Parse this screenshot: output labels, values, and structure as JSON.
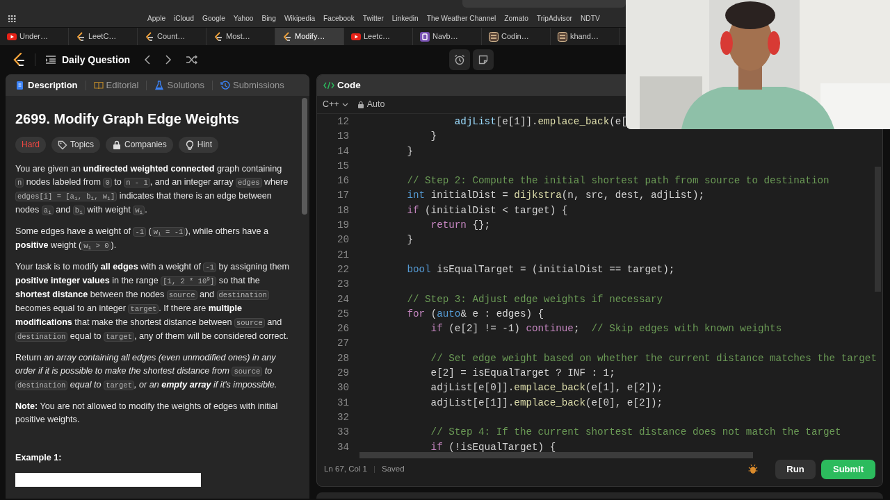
{
  "browser": {
    "bookmarks": [
      "Apple",
      "iCloud",
      "Google",
      "Yahoo",
      "Bing",
      "Wikipedia",
      "Facebook",
      "Twitter",
      "Linkedin",
      "The Weather Channel",
      "Zomato",
      "TripAdvisor",
      "NDTV"
    ],
    "tabs": [
      {
        "label": "Under…",
        "kind": "youtube",
        "selected": false
      },
      {
        "label": "LeetC…",
        "kind": "leetcode",
        "selected": false
      },
      {
        "label": "Count…",
        "kind": "leetcode",
        "selected": false
      },
      {
        "label": "Most…",
        "kind": "leetcode",
        "selected": false
      },
      {
        "label": "Modify…",
        "kind": "leetcode",
        "selected": true
      },
      {
        "label": "Leetc…",
        "kind": "youtube",
        "selected": false
      },
      {
        "label": "Navb…",
        "kind": "bootstrap",
        "selected": false
      },
      {
        "label": "Codin…",
        "kind": "codechef",
        "selected": false
      },
      {
        "label": "khand…",
        "kind": "codechef",
        "selected": false
      }
    ]
  },
  "header": {
    "title": "Daily Question"
  },
  "description": {
    "tabs": [
      {
        "label": "Description",
        "kind": "description",
        "selected": true
      },
      {
        "label": "Editorial",
        "kind": "editorial",
        "selected": false
      },
      {
        "label": "Solutions",
        "kind": "solutions",
        "selected": false
      },
      {
        "label": "Submissions",
        "kind": "submissions",
        "selected": false
      }
    ],
    "title": "2699. Modify Graph Edge Weights",
    "tags": [
      {
        "label": "Hard",
        "kind": "difficulty"
      },
      {
        "label": "Topics",
        "kind": "topics"
      },
      {
        "label": "Companies",
        "kind": "companies"
      },
      {
        "label": "Hint",
        "kind": "hint"
      }
    ],
    "paragraphs": [
      [
        {
          "kind": "plain",
          "text": "You are given an "
        },
        {
          "kind": "bold",
          "text": "undirected weighted connected"
        },
        {
          "kind": "plain",
          "text": " graph containing "
        },
        {
          "kind": "code",
          "text": "n"
        },
        {
          "kind": "plain",
          "text": " nodes labeled from "
        },
        {
          "kind": "code",
          "text": "0"
        },
        {
          "kind": "plain",
          "text": " to "
        },
        {
          "kind": "code",
          "text": "n - 1"
        },
        {
          "kind": "plain",
          "text": ", and an integer array "
        },
        {
          "kind": "code",
          "text": "edges"
        },
        {
          "kind": "plain",
          "text": " where "
        },
        {
          "kind": "code",
          "text": "edges[i] = [a$_{i}$, b$_{i}$, w$_{i}$]"
        },
        {
          "kind": "plain",
          "text": " indicates that there is an edge between nodes "
        },
        {
          "kind": "code",
          "text": "a$_{i}$"
        },
        {
          "kind": "plain",
          "text": " and "
        },
        {
          "kind": "code",
          "text": "b$_{i}$"
        },
        {
          "kind": "plain",
          "text": " with weight "
        },
        {
          "kind": "code",
          "text": "w$_{i}$"
        },
        {
          "kind": "plain",
          "text": "."
        }
      ],
      [
        {
          "kind": "plain",
          "text": "Some edges have a weight of "
        },
        {
          "kind": "code",
          "text": "-1"
        },
        {
          "kind": "plain",
          "text": " ("
        },
        {
          "kind": "code",
          "text": "w$_{i}$ = -1"
        },
        {
          "kind": "plain",
          "text": "), while others have a "
        },
        {
          "kind": "bold",
          "text": "positive"
        },
        {
          "kind": "plain",
          "text": " weight ("
        },
        {
          "kind": "code",
          "text": "w$_{i}$ > 0"
        },
        {
          "kind": "plain",
          "text": ")."
        }
      ],
      [
        {
          "kind": "plain",
          "text": "Your task is to modify "
        },
        {
          "kind": "bold",
          "text": "all edges"
        },
        {
          "kind": "plain",
          "text": " with a weight of "
        },
        {
          "kind": "code",
          "text": "-1"
        },
        {
          "kind": "plain",
          "text": " by assigning them "
        },
        {
          "kind": "bold",
          "text": "positive integer values"
        },
        {
          "kind": "plain",
          "text": " in the range "
        },
        {
          "kind": "code",
          "text": "[1, 2 * 10$^{9}$]"
        },
        {
          "kind": "plain",
          "text": " so that the "
        },
        {
          "kind": "bold",
          "text": "shortest distance"
        },
        {
          "kind": "plain",
          "text": " between the nodes "
        },
        {
          "kind": "code",
          "text": "source"
        },
        {
          "kind": "plain",
          "text": " and "
        },
        {
          "kind": "code",
          "text": "destination"
        },
        {
          "kind": "plain",
          "text": " becomes equal to an integer "
        },
        {
          "kind": "code",
          "text": "target"
        },
        {
          "kind": "plain",
          "text": ". If there are "
        },
        {
          "kind": "bold",
          "text": "multiple modifications"
        },
        {
          "kind": "plain",
          "text": " that make the shortest distance between "
        },
        {
          "kind": "code",
          "text": "source"
        },
        {
          "kind": "plain",
          "text": " and "
        },
        {
          "kind": "code",
          "text": "destination"
        },
        {
          "kind": "plain",
          "text": " equal to "
        },
        {
          "kind": "code",
          "text": "target"
        },
        {
          "kind": "plain",
          "text": ", any of them will be considered correct."
        }
      ],
      [
        {
          "kind": "plain",
          "text": "Return "
        },
        {
          "kind": "italic",
          "text": "an array containing all edges (even unmodified ones) in any order if it is possible to make the shortest distance from "
        },
        {
          "kind": "code",
          "text": "source"
        },
        {
          "kind": "italic",
          "text": " to "
        },
        {
          "kind": "code",
          "text": "destination"
        },
        {
          "kind": "italic",
          "text": " equal to "
        },
        {
          "kind": "code",
          "text": "target"
        },
        {
          "kind": "italic",
          "text": ", or an "
        },
        {
          "kind": "bold-italic",
          "text": "empty array"
        },
        {
          "kind": "italic",
          "text": " if it's impossible."
        }
      ],
      [
        {
          "kind": "bold",
          "text": "Note:"
        },
        {
          "kind": "plain",
          "text": " You are not allowed to modify the weights of edges with initial positive weights."
        }
      ]
    ],
    "example_heading": "Example 1:"
  },
  "editor": {
    "title": "Code",
    "language": "C++",
    "mode": "Auto",
    "lines": [
      {
        "number": "12",
        "tokens": [
          {
            "kind": "variable",
            "text": "                adjList"
          },
          {
            "kind": "plain",
            "text": "[e[1]]."
          },
          {
            "kind": "function",
            "text": "emplace_back"
          },
          {
            "kind": "plain",
            "text": "(e["
          }
        ]
      },
      {
        "number": "13",
        "tokens": [
          {
            "kind": "plain",
            "text": "            }"
          }
        ]
      },
      {
        "number": "14",
        "tokens": [
          {
            "kind": "plain",
            "text": "        }"
          }
        ]
      },
      {
        "number": "15"
      },
      {
        "number": "16",
        "tokens": [
          {
            "kind": "comment",
            "text": "        // Step 2: Compute the initial shortest path from source to destination"
          }
        ]
      },
      {
        "number": "17",
        "tokens": [
          {
            "kind": "type",
            "text": "        int"
          },
          {
            "kind": "plain",
            "text": " initialDist = "
          },
          {
            "kind": "function",
            "text": "dijkstra"
          },
          {
            "kind": "plain",
            "text": "(n, src, dest, adjList);"
          }
        ]
      },
      {
        "number": "18",
        "tokens": [
          {
            "kind": "control",
            "text": "        if"
          },
          {
            "kind": "plain",
            "text": " (initialDist < target) {"
          }
        ]
      },
      {
        "number": "19",
        "tokens": [
          {
            "kind": "control",
            "text": "            return"
          },
          {
            "kind": "plain",
            "text": " {};"
          }
        ]
      },
      {
        "number": "20",
        "tokens": [
          {
            "kind": "plain",
            "text": "        }"
          }
        ]
      },
      {
        "number": "21"
      },
      {
        "number": "22",
        "tokens": [
          {
            "kind": "type",
            "text": "        bool"
          },
          {
            "kind": "plain",
            "text": " isEqualTarget = (initialDist == target);"
          }
        ]
      },
      {
        "number": "23"
      },
      {
        "number": "24",
        "tokens": [
          {
            "kind": "comment",
            "text": "        // Step 3: Adjust edge weights if necessary"
          }
        ]
      },
      {
        "number": "25",
        "tokens": [
          {
            "kind": "control",
            "text": "        for"
          },
          {
            "kind": "plain",
            "text": " ("
          },
          {
            "kind": "type",
            "text": "auto"
          },
          {
            "kind": "plain",
            "text": "& e : edges) {"
          }
        ]
      },
      {
        "number": "26",
        "tokens": [
          {
            "kind": "control",
            "text": "            if"
          },
          {
            "kind": "plain",
            "text": " (e[2] != -1) "
          },
          {
            "kind": "control",
            "text": "continue"
          },
          {
            "kind": "plain",
            "text": ";  "
          },
          {
            "kind": "comment",
            "text": "// Skip edges with known weights"
          }
        ]
      },
      {
        "number": "27"
      },
      {
        "number": "28",
        "tokens": [
          {
            "kind": "comment",
            "text": "            // Set edge weight based on whether the current distance matches the target"
          }
        ]
      },
      {
        "number": "29",
        "tokens": [
          {
            "kind": "plain",
            "text": "            e[2] = isEqualTarget ? INF : 1;"
          }
        ]
      },
      {
        "number": "30",
        "tokens": [
          {
            "kind": "plain",
            "text": "            adjList[e[0]]."
          },
          {
            "kind": "function",
            "text": "emplace_back"
          },
          {
            "kind": "plain",
            "text": "(e[1], e[2]);"
          }
        ]
      },
      {
        "number": "31",
        "tokens": [
          {
            "kind": "plain",
            "text": "            adjList[e[1]]."
          },
          {
            "kind": "function",
            "text": "emplace_back"
          },
          {
            "kind": "plain",
            "text": "(e[0], e[2]);"
          }
        ]
      },
      {
        "number": "32"
      },
      {
        "number": "33",
        "tokens": [
          {
            "kind": "comment",
            "text": "            // Step 4: If the current shortest distance does not match the target"
          }
        ]
      },
      {
        "number": "34",
        "tokens": [
          {
            "kind": "control",
            "text": "            if"
          },
          {
            "kind": "plain",
            "text": " (!isEqualTarget) {"
          }
        ]
      }
    ],
    "status": {
      "position": "Ln 67, Col 1",
      "saved": "Saved"
    },
    "buttons": {
      "run": "Run",
      "submit": "Submit"
    }
  }
}
